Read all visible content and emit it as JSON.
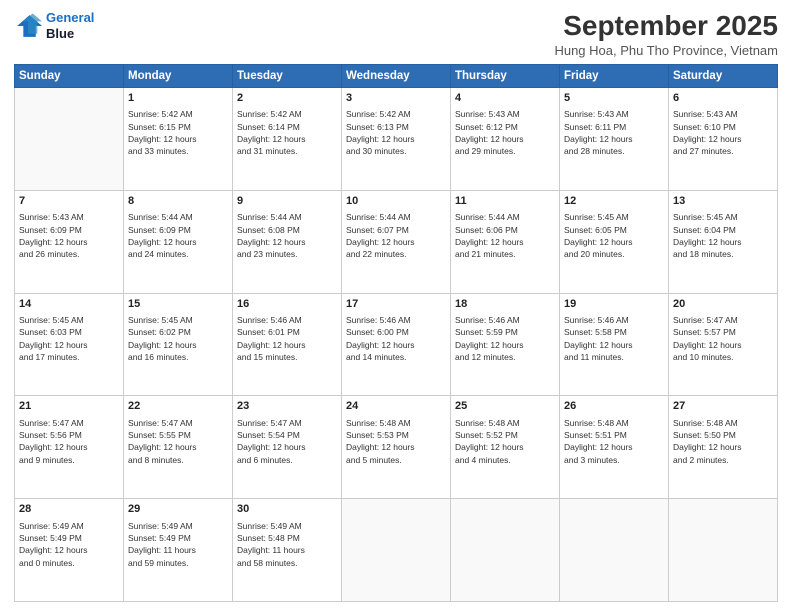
{
  "logo": {
    "line1": "General",
    "line2": "Blue"
  },
  "title": "September 2025",
  "location": "Hung Hoa, Phu Tho Province, Vietnam",
  "weekdays": [
    "Sunday",
    "Monday",
    "Tuesday",
    "Wednesday",
    "Thursday",
    "Friday",
    "Saturday"
  ],
  "weeks": [
    [
      {
        "day": "",
        "info": ""
      },
      {
        "day": "1",
        "info": "Sunrise: 5:42 AM\nSunset: 6:15 PM\nDaylight: 12 hours\nand 33 minutes."
      },
      {
        "day": "2",
        "info": "Sunrise: 5:42 AM\nSunset: 6:14 PM\nDaylight: 12 hours\nand 31 minutes."
      },
      {
        "day": "3",
        "info": "Sunrise: 5:42 AM\nSunset: 6:13 PM\nDaylight: 12 hours\nand 30 minutes."
      },
      {
        "day": "4",
        "info": "Sunrise: 5:43 AM\nSunset: 6:12 PM\nDaylight: 12 hours\nand 29 minutes."
      },
      {
        "day": "5",
        "info": "Sunrise: 5:43 AM\nSunset: 6:11 PM\nDaylight: 12 hours\nand 28 minutes."
      },
      {
        "day": "6",
        "info": "Sunrise: 5:43 AM\nSunset: 6:10 PM\nDaylight: 12 hours\nand 27 minutes."
      }
    ],
    [
      {
        "day": "7",
        "info": "Sunrise: 5:43 AM\nSunset: 6:09 PM\nDaylight: 12 hours\nand 26 minutes."
      },
      {
        "day": "8",
        "info": "Sunrise: 5:44 AM\nSunset: 6:09 PM\nDaylight: 12 hours\nand 24 minutes."
      },
      {
        "day": "9",
        "info": "Sunrise: 5:44 AM\nSunset: 6:08 PM\nDaylight: 12 hours\nand 23 minutes."
      },
      {
        "day": "10",
        "info": "Sunrise: 5:44 AM\nSunset: 6:07 PM\nDaylight: 12 hours\nand 22 minutes."
      },
      {
        "day": "11",
        "info": "Sunrise: 5:44 AM\nSunset: 6:06 PM\nDaylight: 12 hours\nand 21 minutes."
      },
      {
        "day": "12",
        "info": "Sunrise: 5:45 AM\nSunset: 6:05 PM\nDaylight: 12 hours\nand 20 minutes."
      },
      {
        "day": "13",
        "info": "Sunrise: 5:45 AM\nSunset: 6:04 PM\nDaylight: 12 hours\nand 18 minutes."
      }
    ],
    [
      {
        "day": "14",
        "info": "Sunrise: 5:45 AM\nSunset: 6:03 PM\nDaylight: 12 hours\nand 17 minutes."
      },
      {
        "day": "15",
        "info": "Sunrise: 5:45 AM\nSunset: 6:02 PM\nDaylight: 12 hours\nand 16 minutes."
      },
      {
        "day": "16",
        "info": "Sunrise: 5:46 AM\nSunset: 6:01 PM\nDaylight: 12 hours\nand 15 minutes."
      },
      {
        "day": "17",
        "info": "Sunrise: 5:46 AM\nSunset: 6:00 PM\nDaylight: 12 hours\nand 14 minutes."
      },
      {
        "day": "18",
        "info": "Sunrise: 5:46 AM\nSunset: 5:59 PM\nDaylight: 12 hours\nand 12 minutes."
      },
      {
        "day": "19",
        "info": "Sunrise: 5:46 AM\nSunset: 5:58 PM\nDaylight: 12 hours\nand 11 minutes."
      },
      {
        "day": "20",
        "info": "Sunrise: 5:47 AM\nSunset: 5:57 PM\nDaylight: 12 hours\nand 10 minutes."
      }
    ],
    [
      {
        "day": "21",
        "info": "Sunrise: 5:47 AM\nSunset: 5:56 PM\nDaylight: 12 hours\nand 9 minutes."
      },
      {
        "day": "22",
        "info": "Sunrise: 5:47 AM\nSunset: 5:55 PM\nDaylight: 12 hours\nand 8 minutes."
      },
      {
        "day": "23",
        "info": "Sunrise: 5:47 AM\nSunset: 5:54 PM\nDaylight: 12 hours\nand 6 minutes."
      },
      {
        "day": "24",
        "info": "Sunrise: 5:48 AM\nSunset: 5:53 PM\nDaylight: 12 hours\nand 5 minutes."
      },
      {
        "day": "25",
        "info": "Sunrise: 5:48 AM\nSunset: 5:52 PM\nDaylight: 12 hours\nand 4 minutes."
      },
      {
        "day": "26",
        "info": "Sunrise: 5:48 AM\nSunset: 5:51 PM\nDaylight: 12 hours\nand 3 minutes."
      },
      {
        "day": "27",
        "info": "Sunrise: 5:48 AM\nSunset: 5:50 PM\nDaylight: 12 hours\nand 2 minutes."
      }
    ],
    [
      {
        "day": "28",
        "info": "Sunrise: 5:49 AM\nSunset: 5:49 PM\nDaylight: 12 hours\nand 0 minutes."
      },
      {
        "day": "29",
        "info": "Sunrise: 5:49 AM\nSunset: 5:49 PM\nDaylight: 11 hours\nand 59 minutes."
      },
      {
        "day": "30",
        "info": "Sunrise: 5:49 AM\nSunset: 5:48 PM\nDaylight: 11 hours\nand 58 minutes."
      },
      {
        "day": "",
        "info": ""
      },
      {
        "day": "",
        "info": ""
      },
      {
        "day": "",
        "info": ""
      },
      {
        "day": "",
        "info": ""
      }
    ]
  ]
}
